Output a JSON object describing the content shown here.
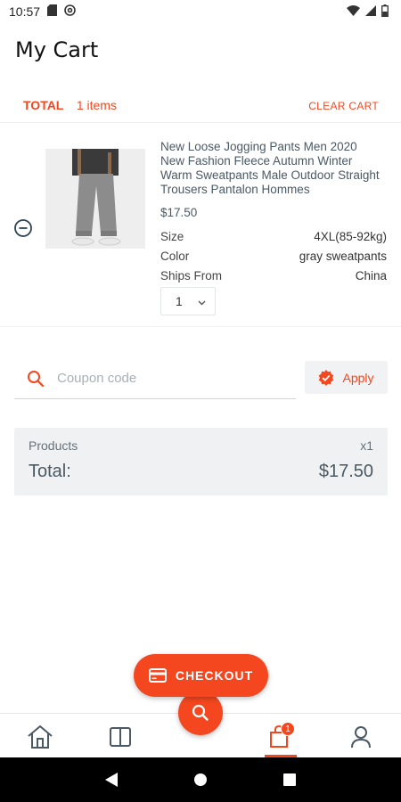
{
  "status_bar": {
    "time": "10:57",
    "icons_left": [
      "sd-card-icon",
      "at-sign-icon"
    ],
    "icons_right": [
      "wifi-icon",
      "signal-icon",
      "battery-icon"
    ]
  },
  "header": {
    "title": "My Cart"
  },
  "cart_summary": {
    "total_label": "TOTAL",
    "item_count": "1 items",
    "clear_label": "CLEAR CART"
  },
  "cart_items": [
    {
      "title": "New Loose Jogging Pants Men 2020 New Fashion Fleece Autumn Winter Warm Sweatpants Male Outdoor Straight Trousers Pantalon Hommes",
      "price": "$17.50",
      "specs": [
        {
          "key": "Size",
          "value": "4XL(85-92kg)"
        },
        {
          "key": "Color",
          "value": "gray sweatpants"
        },
        {
          "key": "Ships From",
          "value": "China"
        }
      ],
      "quantity": "1"
    }
  ],
  "coupon": {
    "placeholder": "Coupon code",
    "value": "",
    "apply_label": "Apply"
  },
  "totals": {
    "products_label": "Products",
    "products_qty": "x1",
    "total_label": "Total:",
    "total_value": "$17.50"
  },
  "checkout": {
    "label": "CHECKOUT"
  },
  "bottom_nav": {
    "items": [
      "home-icon",
      "categories-icon",
      "search-icon",
      "cart-icon",
      "profile-icon"
    ],
    "cart_badge": "1",
    "active": "cart"
  },
  "colors": {
    "accent": "#f4471f",
    "text_muted": "#4a5963",
    "panel": "#eff1f3"
  }
}
